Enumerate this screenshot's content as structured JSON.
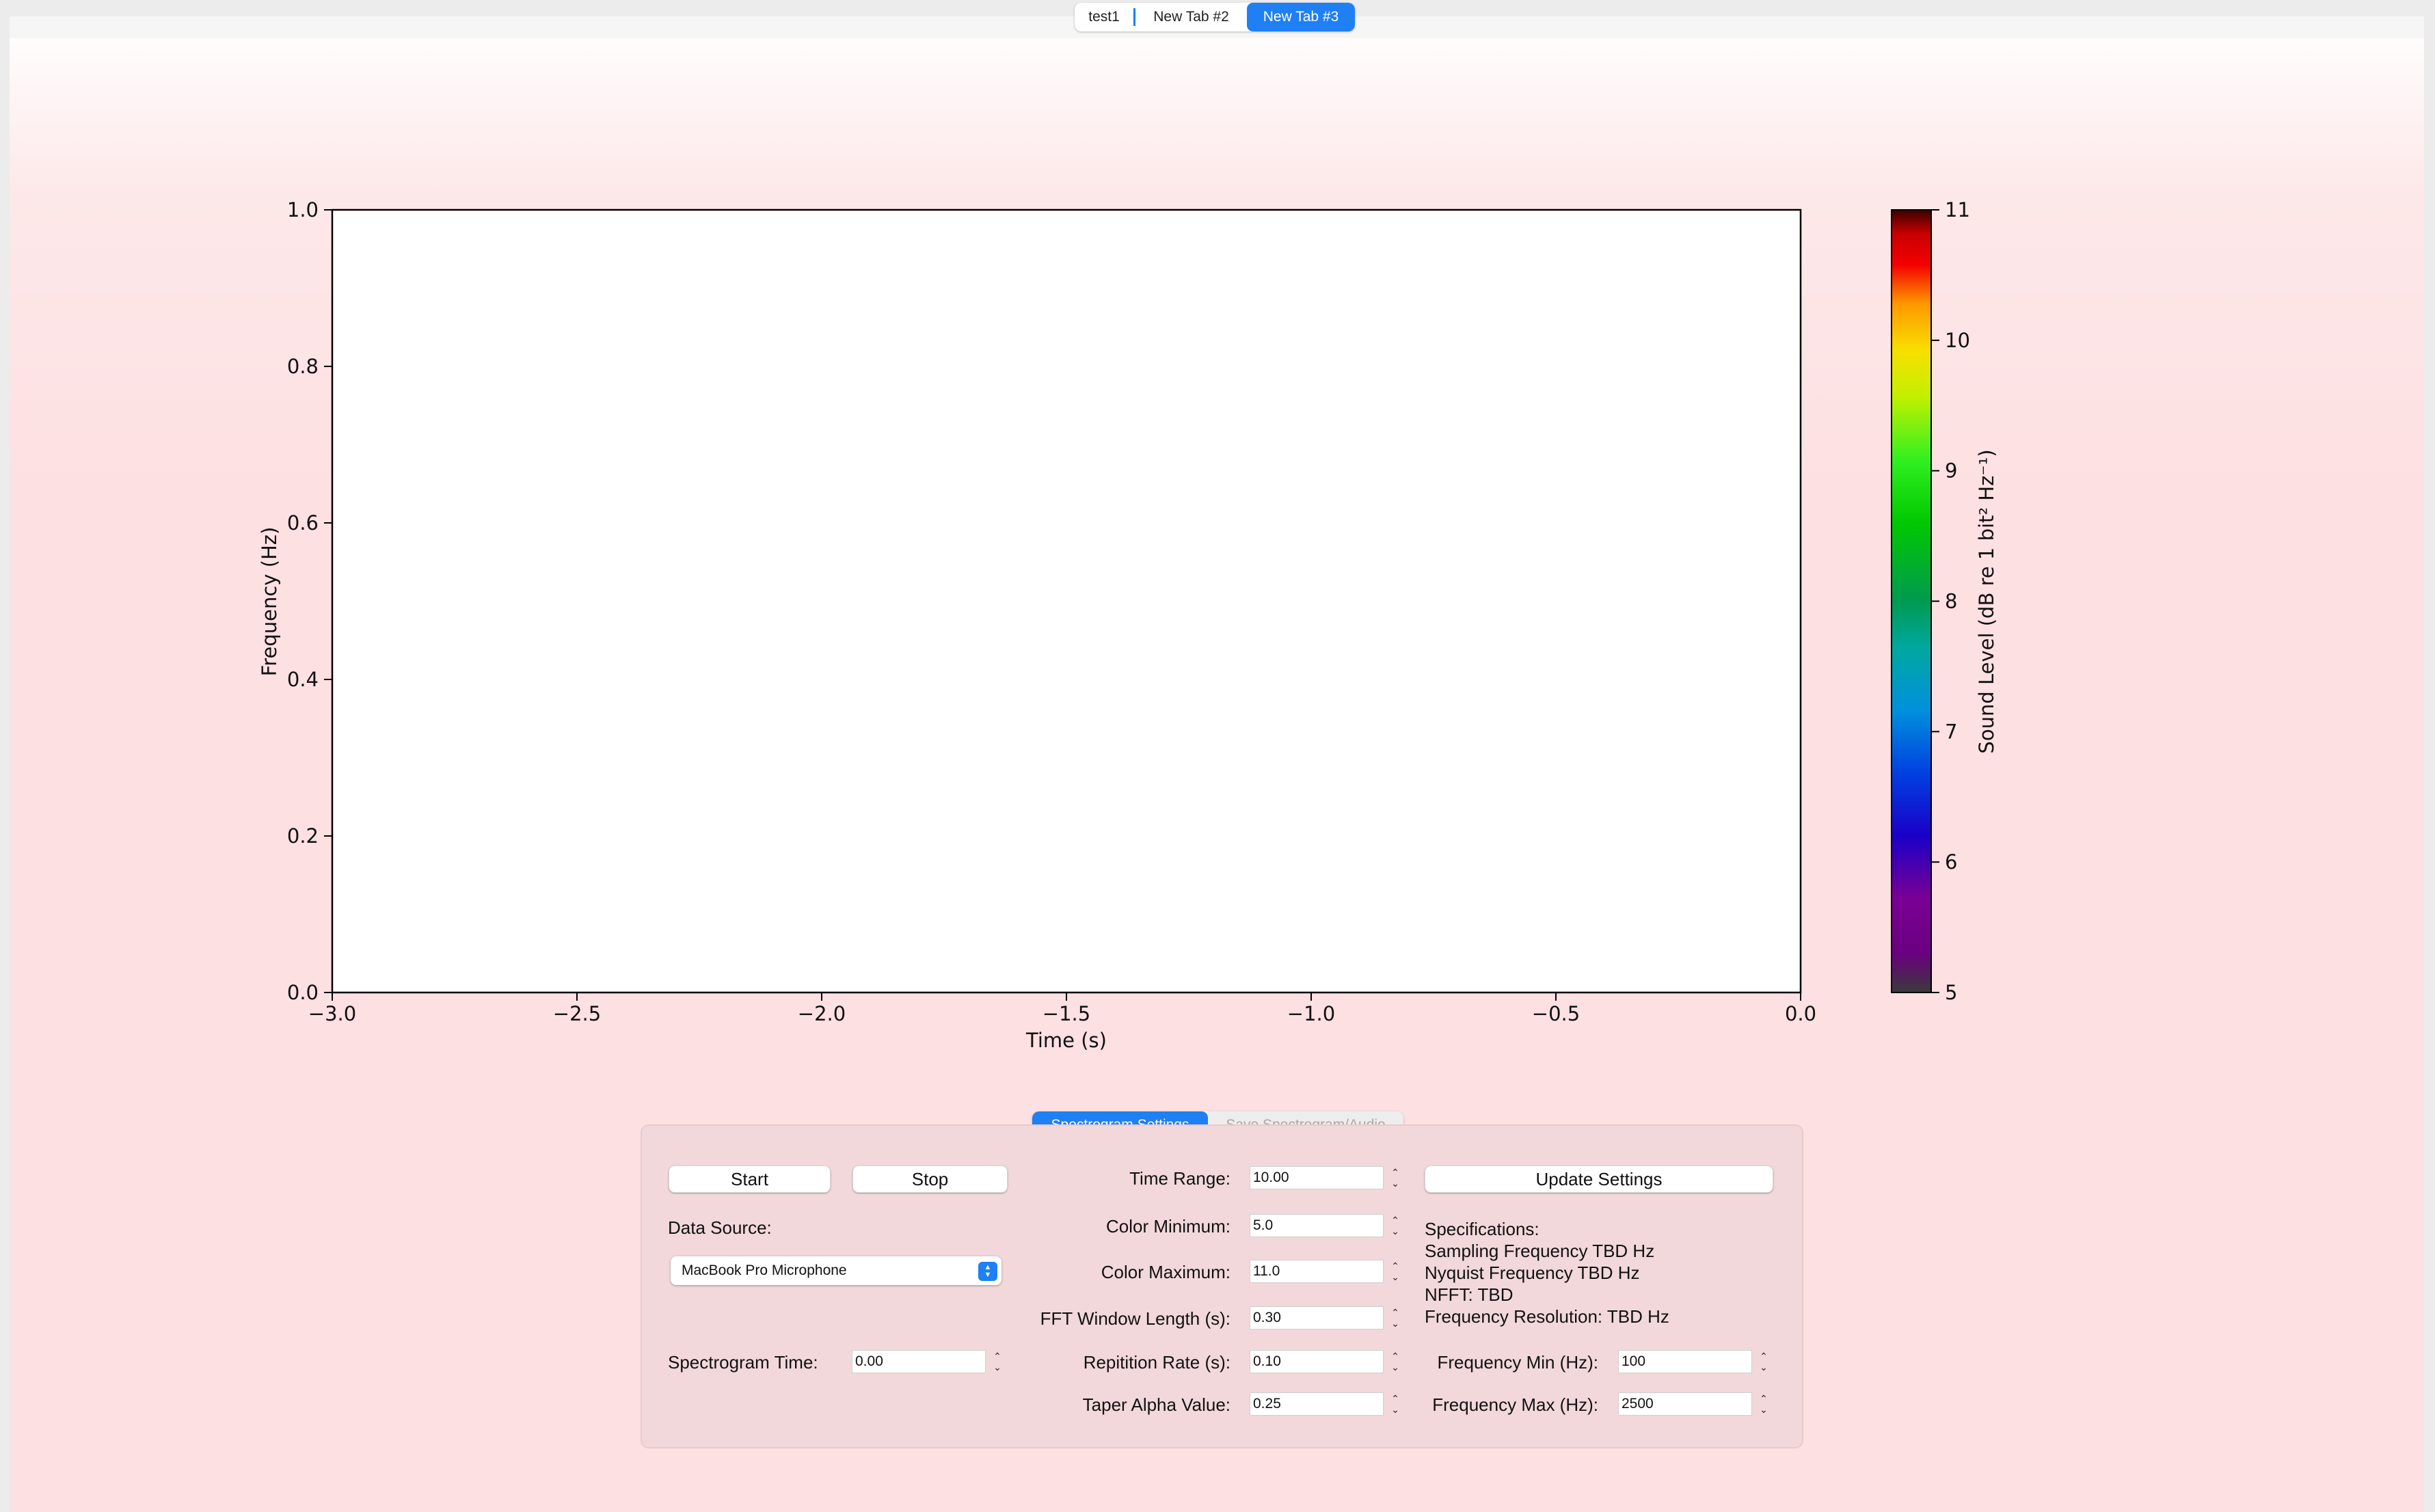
{
  "window_tabs": [
    {
      "label": "test1",
      "active": false
    },
    {
      "label": "New Tab #2",
      "active": false
    },
    {
      "label": "New Tab #3",
      "active": true
    }
  ],
  "plot": {
    "xlabel": "Time (s)",
    "ylabel": "Frequency (Hz)",
    "xticks": [
      "−3.0",
      "−2.5",
      "−2.0",
      "−1.5",
      "−1.0",
      "−0.5",
      "0.0"
    ],
    "yticks": [
      "0.0",
      "0.2",
      "0.4",
      "0.6",
      "0.8",
      "1.0"
    ]
  },
  "colorbar": {
    "label": "Sound Level (dB re 1 bit² Hz⁻¹)",
    "ticks": [
      "5",
      "6",
      "7",
      "8",
      "9",
      "10",
      "11"
    ],
    "min": 5,
    "max": 11,
    "colormap": "nipy_spectral"
  },
  "panel_tabs": [
    {
      "label": "Spectrogram Settings",
      "active": true
    },
    {
      "label": "Save Spectrogram/Audio",
      "active": false
    }
  ],
  "controls": {
    "start_label": "Start",
    "stop_label": "Stop",
    "data_source_label": "Data Source:",
    "data_source_value": "MacBook Pro Microphone",
    "spectrogram_time_label": "Spectrogram Time:",
    "spectrogram_time_value": "0.00",
    "time_range_label": "Time Range:",
    "time_range_value": "10.00",
    "color_min_label": "Color Minimum:",
    "color_min_value": "5.0",
    "color_max_label": "Color Maximum:",
    "color_max_value": "11.0",
    "fft_window_label": "FFT Window Length (s):",
    "fft_window_value": "0.30",
    "repetition_label": "Repitition Rate (s):",
    "repetition_value": "0.10",
    "taper_label": "Taper Alpha Value:",
    "taper_value": "0.25",
    "update_label": "Update Settings",
    "freq_min_label": "Frequency Min (Hz):",
    "freq_min_value": "100",
    "freq_max_label": "Frequency Max (Hz):",
    "freq_max_value": "2500"
  },
  "specifications": {
    "heading": "Specifications:",
    "sampling": "Sampling Frequency TBD Hz",
    "nyquist": "Nyquist Frequency TBD Hz",
    "nfft": "NFFT: TBD",
    "resolution": "Frequency Resolution: TBD Hz"
  },
  "chart_data": {
    "type": "heatmap",
    "title": "",
    "xlabel": "Time (s)",
    "ylabel": "Frequency (Hz)",
    "xlim": [
      -3.0,
      0.0
    ],
    "ylim": [
      0.0,
      1.0
    ],
    "x_ticks": [
      -3.0,
      -2.5,
      -2.0,
      -1.5,
      -1.0,
      -0.5,
      0.0
    ],
    "y_ticks": [
      0.0,
      0.2,
      0.4,
      0.6,
      0.8,
      1.0
    ],
    "values": [],
    "colorbar": {
      "label": "Sound Level (dB re 1 bit² Hz⁻¹)",
      "range": [
        5,
        11
      ],
      "ticks": [
        5,
        6,
        7,
        8,
        9,
        10,
        11
      ]
    },
    "grid": false
  }
}
